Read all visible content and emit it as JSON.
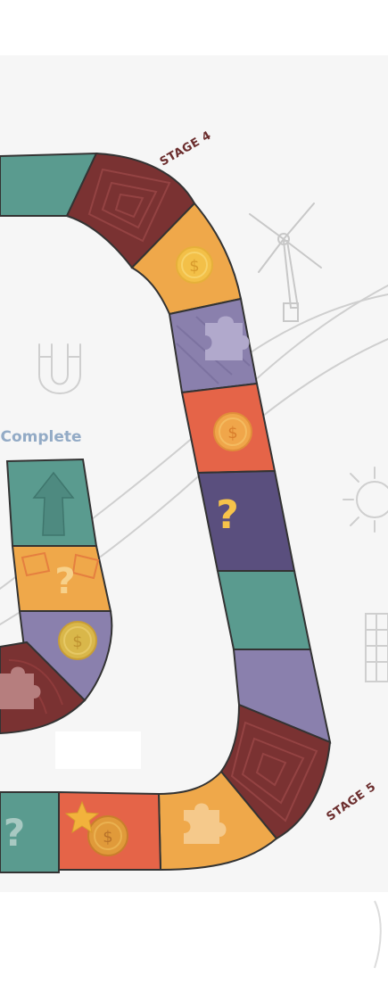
{
  "board": {
    "stage_4_label": "STAGE 4",
    "stage_5_label": "STAGE 5",
    "complete_label": "Complete",
    "question_mark": "?",
    "coin_symbol": "$"
  },
  "colors": {
    "background_panel": "#f6f6f6",
    "teal": "#5a9b8f",
    "maroon": "#7a3232",
    "orange": "#efa84a",
    "lavender": "#8a80ad",
    "coral": "#e56448",
    "indigo": "#5a4f7e",
    "stage_text": "#6b2d2d",
    "complete_text": "#93abc6",
    "question_yellow": "#f7c34a",
    "outline": "#333333",
    "sketch": "#c8c8c8"
  },
  "icons": {
    "windmill": "windmill-icon",
    "magnet": "magnet-icon",
    "sun": "sun-icon",
    "solar_panel": "solar-panel-icon",
    "puzzle": "puzzle-icon",
    "coin": "coin-icon",
    "question": "question-mark-icon",
    "arrow": "arrow-up-icon",
    "star": "star-icon"
  }
}
